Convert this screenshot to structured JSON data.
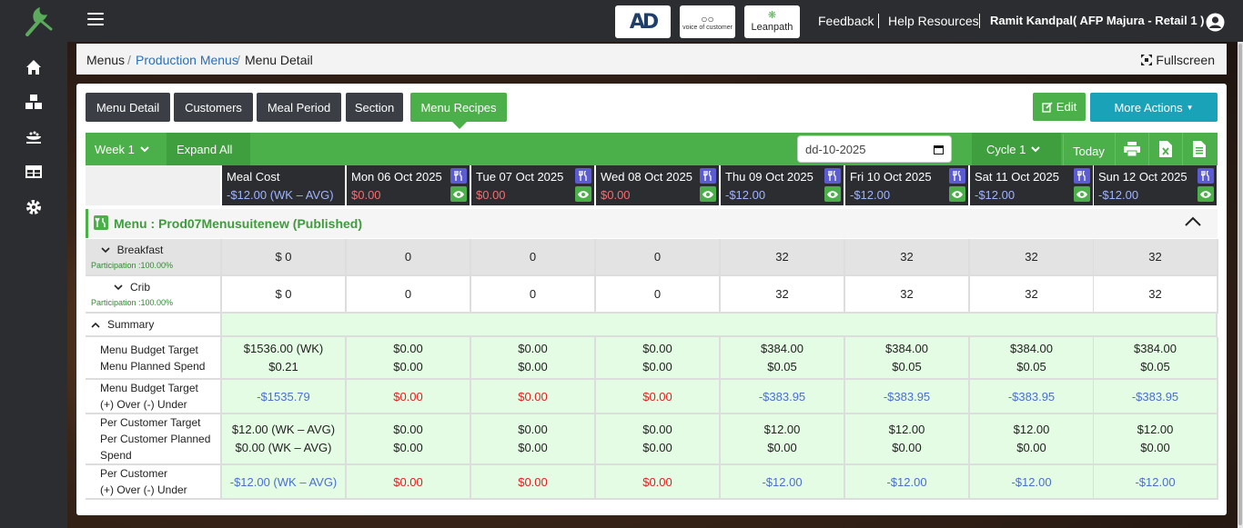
{
  "header": {
    "brands": [
      "voice of customer",
      "Leanpath"
    ],
    "links": [
      "Feedback",
      "Help Resources"
    ],
    "user": "Ramit Kandpal( AFP Majura - Retail 1 )"
  },
  "sidebar": {
    "icons": [
      "home-icon",
      "boxes-icon",
      "dish-icon",
      "grid-icon",
      "gear-icon"
    ]
  },
  "breadcrumb": {
    "items": [
      "Menus",
      "Production Menus",
      "Menu Detail"
    ],
    "fullscreen": "Fullscreen"
  },
  "tabs": [
    "Menu Detail",
    "Customers",
    "Meal Period",
    "Section",
    "Menu Recipes"
  ],
  "actions": {
    "edit": "Edit",
    "more": "More Actions"
  },
  "toolbar": {
    "week": "Week 1",
    "expand": "Expand All",
    "date_placeholder": "dd-10-2025",
    "cycle": "Cycle 1",
    "today": "Today"
  },
  "columns": {
    "meal_cost": {
      "label": "Meal Cost",
      "value": "-$12.00 (WK – AVG)"
    },
    "days": [
      {
        "label": "Mon 06 Oct 2025",
        "value": "$0.00"
      },
      {
        "label": "Tue 07 Oct 2025",
        "value": "$0.00"
      },
      {
        "label": "Wed 08 Oct 2025",
        "value": "$0.00"
      },
      {
        "label": "Thu 09 Oct 2025",
        "value": "-$12.00"
      },
      {
        "label": "Fri 10 Oct 2025",
        "value": "-$12.00"
      },
      {
        "label": "Sat 11 Oct 2025",
        "value": "-$12.00"
      },
      {
        "label": "Sun 12 Oct 2025",
        "value": "-$12.00"
      }
    ]
  },
  "menu": {
    "title": "Menu :  Prod07Menusuitenew  (Published)"
  },
  "meals": [
    {
      "name": "Breakfast",
      "participation": "Participation :100.00%",
      "total": "$ 0",
      "days": [
        "0",
        "0",
        "0",
        "32",
        "32",
        "32",
        "32"
      ]
    },
    {
      "name": "Crib",
      "participation": "Participation :100.00%",
      "total": "$ 0",
      "days": [
        "0",
        "0",
        "0",
        "32",
        "32",
        "32",
        "32"
      ]
    }
  ],
  "summary": {
    "label": "Summary",
    "rows": {
      "budget": {
        "label1": "Menu Budget Target",
        "label2": "Menu Planned Spend",
        "total1": "$1536.00 (WK)",
        "total2": "$0.21",
        "days1": [
          "$0.00",
          "$0.00",
          "$0.00",
          "$384.00",
          "$384.00",
          "$384.00",
          "$384.00"
        ],
        "days2": [
          "$0.00",
          "$0.00",
          "$0.00",
          "$0.05",
          "$0.05",
          "$0.05",
          "$0.05"
        ]
      },
      "over_under": {
        "label1": "Menu Budget Target",
        "label2": "(+) Over (-) Under",
        "total": "-$1535.79",
        "days": [
          "$0.00",
          "$0.00",
          "$0.00",
          "-$383.95",
          "-$383.95",
          "-$383.95",
          "-$383.95"
        ]
      },
      "per_customer": {
        "label1": "Per Customer Target",
        "label2": "Per Customer Planned",
        "label3": "Spend",
        "total1": "$12.00 (WK – AVG)",
        "total2": "$0.00 (WK – AVG)",
        "days1": [
          "$0.00",
          "$0.00",
          "$0.00",
          "$12.00",
          "$12.00",
          "$12.00",
          "$12.00"
        ],
        "days2": [
          "$0.00",
          "$0.00",
          "$0.00",
          "$0.00",
          "$0.00",
          "$0.00",
          "$0.00"
        ]
      },
      "per_customer_over": {
        "label1": "Per Customer",
        "label2": "(+) Over (-) Under",
        "total": "-$12.00 (WK – AVG)",
        "days": [
          "$0.00",
          "$0.00",
          "$0.00",
          "-$12.00",
          "-$12.00",
          "-$12.00",
          "-$12.00"
        ]
      }
    }
  },
  "colors": {
    "green": "#4bb04a",
    "dark": "#2b2d31",
    "teal": "#1aa3b8",
    "red": "#e02020",
    "blue": "#4a6fd0"
  }
}
